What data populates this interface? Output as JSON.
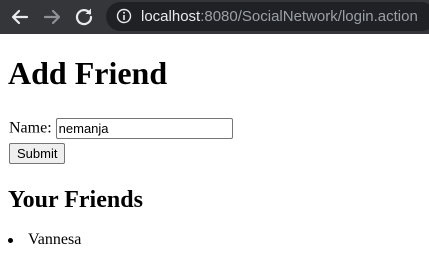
{
  "browser": {
    "url_host": "localhost",
    "url_rest": ":8080/SocialNetwork/login.action",
    "icons": {
      "back": "arrow-left-icon",
      "forward": "arrow-right-icon",
      "reload": "reload-icon",
      "site_info": "info-icon"
    },
    "colors": {
      "toolbar": "#35363a",
      "omnibox": "#202124",
      "host_text": "#e8eaed",
      "path_text": "#9aa0a6"
    }
  },
  "page": {
    "title": "Add Friend",
    "form": {
      "name_label": "Name:",
      "name_value": "nemanja",
      "submit_label": "Submit"
    },
    "friends_title": "Your Friends",
    "friends": [
      "Vannesa"
    ]
  }
}
